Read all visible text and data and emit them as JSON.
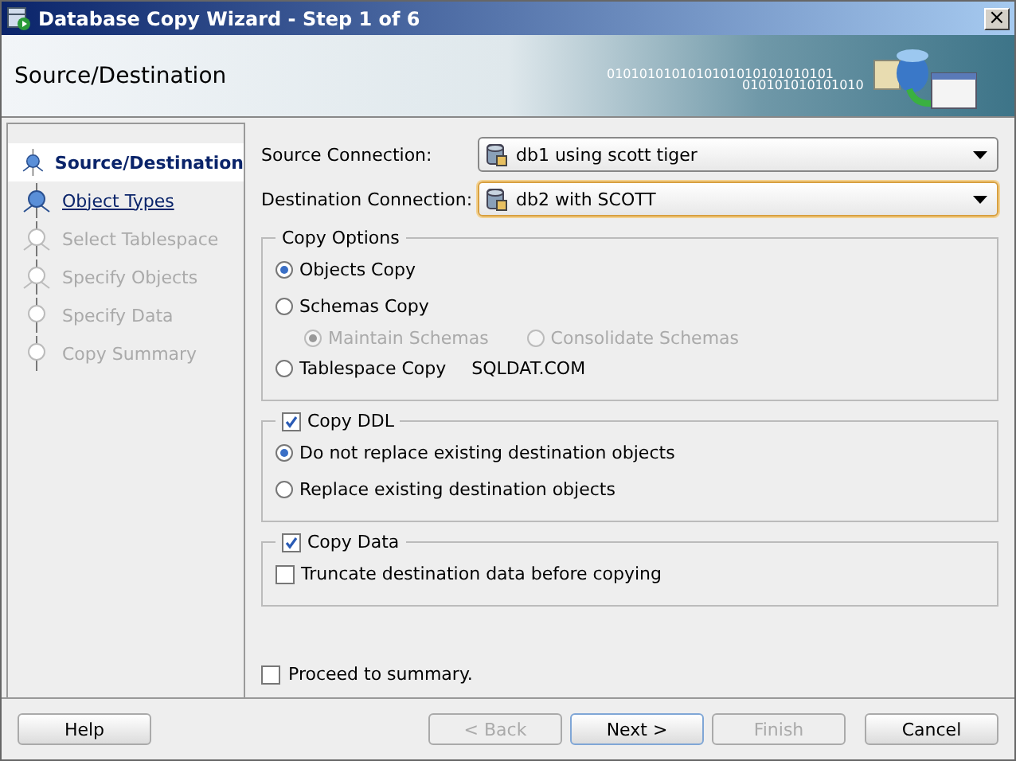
{
  "window": {
    "title": "Database Copy Wizard - Step 1 of 6",
    "close": "×"
  },
  "header": {
    "title": "Source/Destination",
    "banner_text": [
      "0101010101010101010101010101",
      "010101010101010"
    ]
  },
  "steps": [
    {
      "label": "Source/Destination",
      "selected": true,
      "enabled": true
    },
    {
      "label": "Object Types",
      "selected": false,
      "enabled": true
    },
    {
      "label": "Select Tablespace",
      "selected": false,
      "enabled": false
    },
    {
      "label": "Specify Objects",
      "selected": false,
      "enabled": false
    },
    {
      "label": "Specify Data",
      "selected": false,
      "enabled": false
    },
    {
      "label": "Copy Summary",
      "selected": false,
      "enabled": false
    }
  ],
  "connections": [
    {
      "label": "Source Connection:",
      "value": "db1 using scott tiger",
      "focused": false
    },
    {
      "label": "Destination Connection:",
      "value": "db2 with SCOTT",
      "focused": true
    }
  ],
  "copy_options": {
    "title": "Copy Options",
    "options": [
      {
        "label": "Objects Copy",
        "selected": true
      },
      {
        "label": "Schemas Copy",
        "selected": false,
        "sub_options": [
          {
            "label": "Maintain Schemas",
            "selected": true,
            "disabled": true
          },
          {
            "label": "Consolidate Schemas",
            "selected": false,
            "disabled": true
          }
        ]
      },
      {
        "label": "Tablespace Copy",
        "selected": false,
        "note": "SQLDAT.COM"
      }
    ]
  },
  "copy_ddl": {
    "label": "Copy DDL",
    "checked": true,
    "options": [
      {
        "kind": "radio",
        "label": "Do not replace existing destination objects",
        "selected": true
      },
      {
        "kind": "radio",
        "label": "Replace existing destination objects",
        "selected": false
      }
    ]
  },
  "copy_data": {
    "label": "Copy Data",
    "checked": true,
    "options": [
      {
        "kind": "checkbox",
        "label": "Truncate destination data before copying",
        "checked": false
      }
    ]
  },
  "proceed": {
    "label": "Proceed to summary.",
    "checked": false
  },
  "buttons": [
    {
      "label": "Help",
      "disabled": false,
      "default": false
    },
    {
      "label": "< Back",
      "disabled": true,
      "default": false
    },
    {
      "label": "Next >",
      "disabled": false,
      "default": true
    },
    {
      "label": "Finish",
      "disabled": true,
      "default": false
    },
    {
      "label": "Cancel",
      "disabled": false,
      "default": false
    }
  ]
}
